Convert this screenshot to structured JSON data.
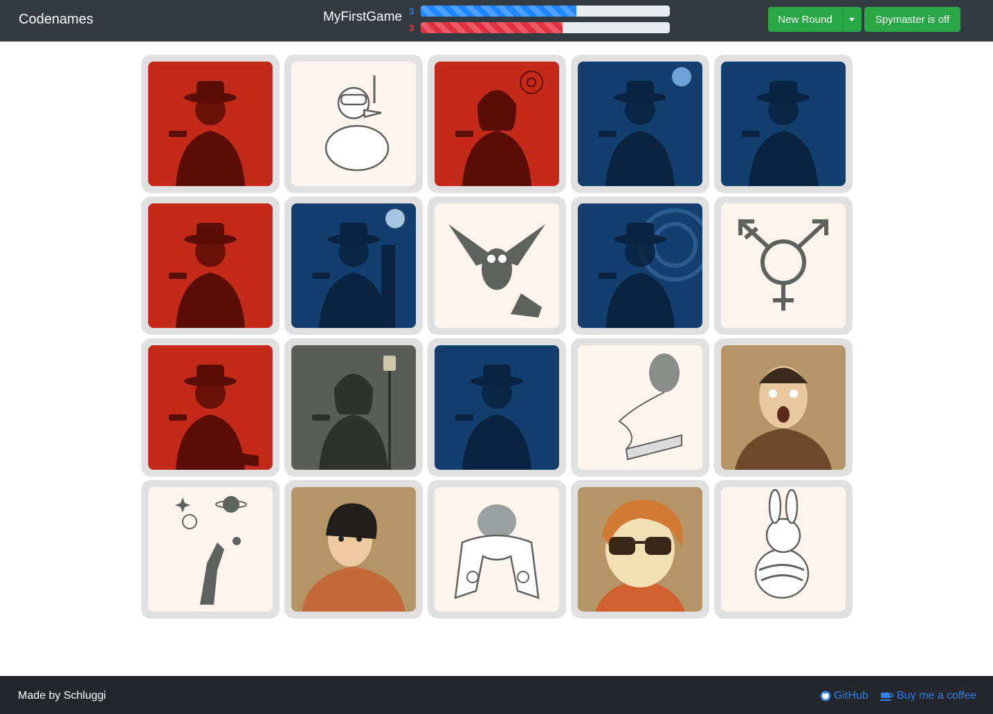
{
  "navbar": {
    "brand": "Codenames",
    "game_name": "MyFirstGame",
    "blue_remaining": "3",
    "red_remaining": "3",
    "blue_progress": 0.625,
    "red_progress": 0.57,
    "colors": {
      "blue": "#1f86ff",
      "red": "#e0313f"
    },
    "new_round_label": "New Round",
    "spymaster_label": "Spymaster is off"
  },
  "board": {
    "cards": [
      {
        "picture": "agent-man-gun",
        "team": "red"
      },
      {
        "picture": "duck-snorkel",
        "team": "none"
      },
      {
        "picture": "agent-woman-target",
        "team": "red"
      },
      {
        "picture": "agent-woman-moon",
        "team": "blue"
      },
      {
        "picture": "agent-man-gun",
        "team": "blue"
      },
      {
        "picture": "agent-woman-trenchcoat",
        "team": "red"
      },
      {
        "picture": "agent-woman-city",
        "team": "blue"
      },
      {
        "picture": "owl-high-heel",
        "team": "none"
      },
      {
        "picture": "agent-man-radar",
        "team": "blue"
      },
      {
        "picture": "transgender-symbol",
        "team": "none"
      },
      {
        "picture": "agent-man-sitting",
        "team": "red"
      },
      {
        "picture": "hooded-figure-lamppost",
        "team": "assassin"
      },
      {
        "picture": "agent-man-dark",
        "team": "blue"
      },
      {
        "picture": "balloon-clothespin",
        "team": "none"
      },
      {
        "picture": "surprised-man",
        "team": "bystander"
      },
      {
        "picture": "hand-planets-stars",
        "team": "none"
      },
      {
        "picture": "confused-woman",
        "team": "bystander"
      },
      {
        "picture": "bird-scarf",
        "team": "none"
      },
      {
        "picture": "boy-sunglasses",
        "team": "bystander"
      },
      {
        "picture": "rabbit-rope",
        "team": "none"
      }
    ]
  },
  "footer": {
    "made_by": "Made by Schluggi",
    "github_label": "GitHub",
    "coffee_label": "Buy me a coffee"
  }
}
